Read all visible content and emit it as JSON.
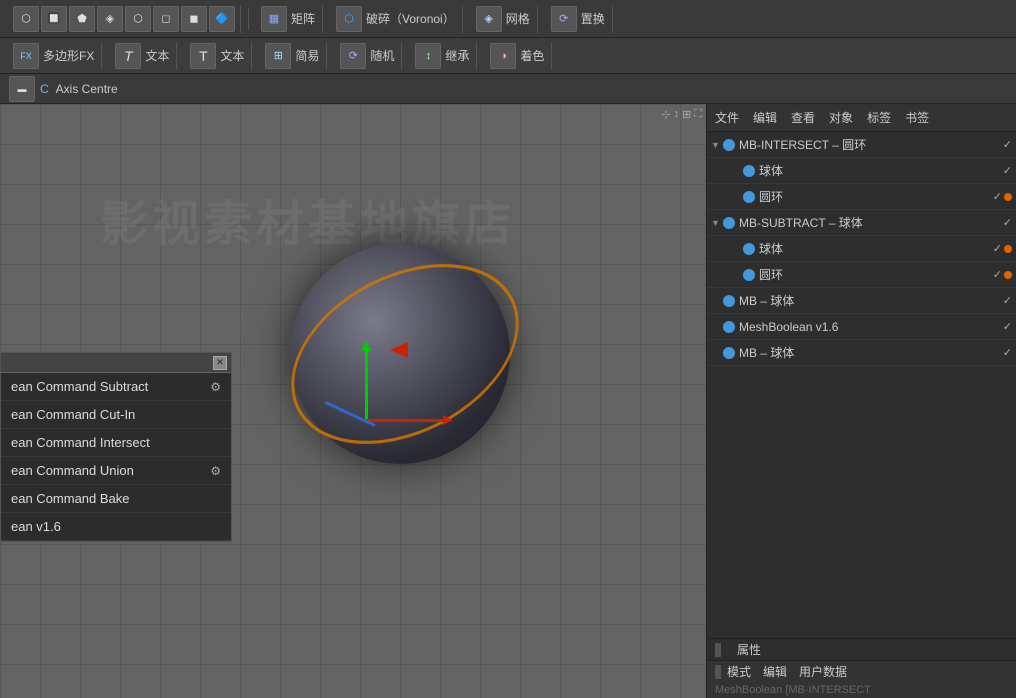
{
  "toolbars": {
    "first": {
      "groups": [
        {
          "label": "矩阵"
        },
        {
          "label": "破碎（Voronoi）"
        },
        {
          "label": "网格"
        },
        {
          "label": "置换"
        }
      ]
    },
    "second": {
      "groups": [
        {
          "label": "多边形FX"
        },
        {
          "label": "文本"
        },
        {
          "label": "文本"
        },
        {
          "label": "简易"
        },
        {
          "label": "随机"
        },
        {
          "label": "继承"
        },
        {
          "label": "着色"
        }
      ]
    },
    "third": {
      "axis_label": "Axis Centre"
    }
  },
  "right_panel": {
    "menu_items": [
      "文件",
      "编辑",
      "查看",
      "对象",
      "标签",
      "书签"
    ],
    "tree_items": [
      {
        "id": "mb-intersect",
        "label": "MB-INTERSECT – 圆环",
        "color": "#4499dd",
        "indent": 0,
        "has_expand": true,
        "selected": false,
        "check": true,
        "dot_orange": false
      },
      {
        "id": "sphere-1",
        "label": "球体",
        "color": "#4499dd",
        "indent": 1,
        "has_expand": false,
        "selected": false,
        "check": true,
        "dot_orange": false
      },
      {
        "id": "torus-1",
        "label": "圆环",
        "color": "#4499dd",
        "indent": 1,
        "has_expand": false,
        "selected": false,
        "check": true,
        "dot_orange": true
      },
      {
        "id": "mb-subtract",
        "label": "MB-SUBTRACT – 球体",
        "color": "#4499dd",
        "indent": 0,
        "has_expand": true,
        "selected": false,
        "check": true,
        "dot_orange": false
      },
      {
        "id": "sphere-2",
        "label": "球体",
        "color": "#4499dd",
        "indent": 1,
        "has_expand": false,
        "selected": false,
        "check": true,
        "dot_orange": true
      },
      {
        "id": "torus-2",
        "label": "圆环",
        "color": "#4499dd",
        "indent": 1,
        "has_expand": false,
        "selected": false,
        "check": true,
        "dot_orange": true
      },
      {
        "id": "mb-sphere",
        "label": "MB – 球体",
        "color": "#4499dd",
        "indent": 0,
        "has_expand": false,
        "selected": false,
        "check": true,
        "dot_orange": false
      },
      {
        "id": "meshboolean",
        "label": "MeshBoolean v1.6",
        "color": "#4499dd",
        "indent": 0,
        "has_expand": false,
        "selected": false,
        "check": true,
        "dot_orange": false
      },
      {
        "id": "mb-sphere-2",
        "label": "MB – 球体",
        "color": "#4499dd",
        "indent": 0,
        "has_expand": false,
        "selected": false,
        "check": true,
        "dot_orange": false
      }
    ]
  },
  "bottom_panel": {
    "header_items": [
      "属性"
    ],
    "sub_items": [
      "模式",
      "编辑",
      "用户数据"
    ],
    "content_label": "MeshBoolean [MB-INTERSECT"
  },
  "context_menu": {
    "title": "",
    "items": [
      {
        "label": "ean Command Subtract",
        "has_gear": true,
        "has_bullet": false
      },
      {
        "label": "ean Command Cut-In",
        "has_gear": false,
        "has_bullet": false
      },
      {
        "label": "ean Command Intersect",
        "has_gear": false,
        "has_bullet": false
      },
      {
        "label": "ean Command Union",
        "has_gear": true,
        "has_bullet": false
      },
      {
        "label": "ean Command Bake",
        "has_gear": false,
        "has_bullet": false
      },
      {
        "label": "ean v1.6",
        "has_gear": false,
        "has_bullet": false
      }
    ]
  },
  "viewport": {
    "watermark": "影视素材基地旗店"
  }
}
